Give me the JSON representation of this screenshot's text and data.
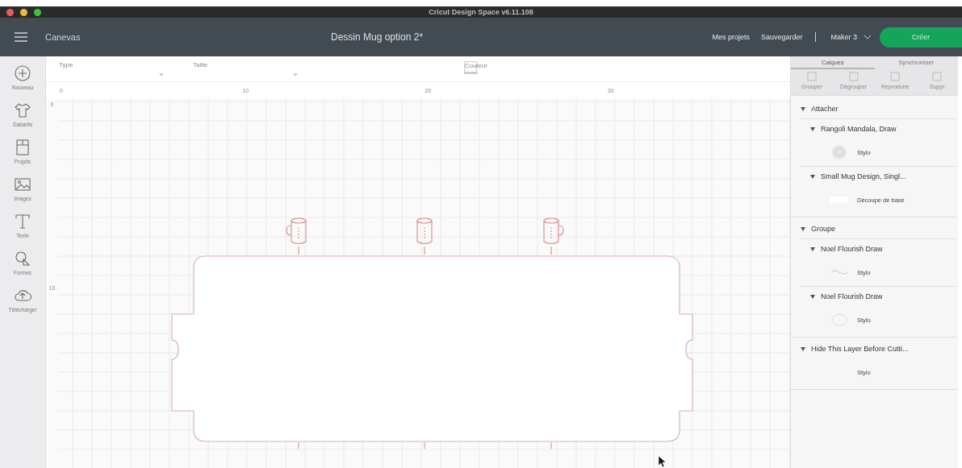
{
  "title_bar": {
    "title": "Cricut Design Space v6.11.108"
  },
  "header": {
    "section": "Canevas",
    "project": "Dessin Mug option 2*",
    "links": [
      "Mes projets",
      "Sauvegarder"
    ],
    "machine": "Maker 3",
    "make_button": "Créer"
  },
  "sidebar": {
    "items": [
      {
        "label": "Nouveau",
        "kind": "plus"
      },
      {
        "label": "Gabarits",
        "kind": "shirt"
      },
      {
        "label": "Projets",
        "kind": "book"
      },
      {
        "label": "Images",
        "kind": "image"
      },
      {
        "label": "Texte",
        "kind": "text"
      },
      {
        "label": "Formes",
        "kind": "shapes"
      },
      {
        "label": "Télécharger",
        "kind": "upload"
      }
    ]
  },
  "toolbar": {
    "fields": [
      {
        "label": "Type",
        "kind": "select"
      },
      {
        "label": "Taille",
        "kind": "select"
      },
      {
        "label": "Couleur",
        "kind": "swatch"
      }
    ]
  },
  "ruler": {
    "horizontal": [
      "0",
      "10",
      "20",
      "30"
    ],
    "vertical": [
      "0",
      "10"
    ]
  },
  "layers_panel": {
    "tabs": [
      {
        "label": "Calques",
        "selected": true
      },
      {
        "label": "Synchroniser",
        "selected": false
      }
    ],
    "actions": [
      "Grouper",
      "Dégrouper",
      "Reproduire",
      "Suppr"
    ],
    "groups": [
      {
        "name": "Attacher",
        "expanded": true,
        "children": [
          {
            "name": "Rangoli Mandala, Draw",
            "expanded": true,
            "items": [
              {
                "label": "Stylo",
                "kind": "mandala"
              }
            ]
          },
          {
            "name": "Small Mug Design, Singl...",
            "expanded": true,
            "items": [
              {
                "label": "Découpe de base",
                "kind": "blank"
              }
            ]
          }
        ]
      },
      {
        "name": "Groupe",
        "expanded": true,
        "children": [
          {
            "name": "Noel Flourish Draw",
            "expanded": true,
            "items": [
              {
                "label": "Stylo",
                "kind": "flourish"
              }
            ]
          },
          {
            "name": "Noel Flourish Draw",
            "expanded": true,
            "items": [
              {
                "label": "Stylo",
                "kind": "wreath"
              }
            ]
          }
        ]
      },
      {
        "name": "Hide This Layer Before Cutti...",
        "expanded": true,
        "items": [
          {
            "label": "Stylo"
          }
        ]
      }
    ]
  }
}
